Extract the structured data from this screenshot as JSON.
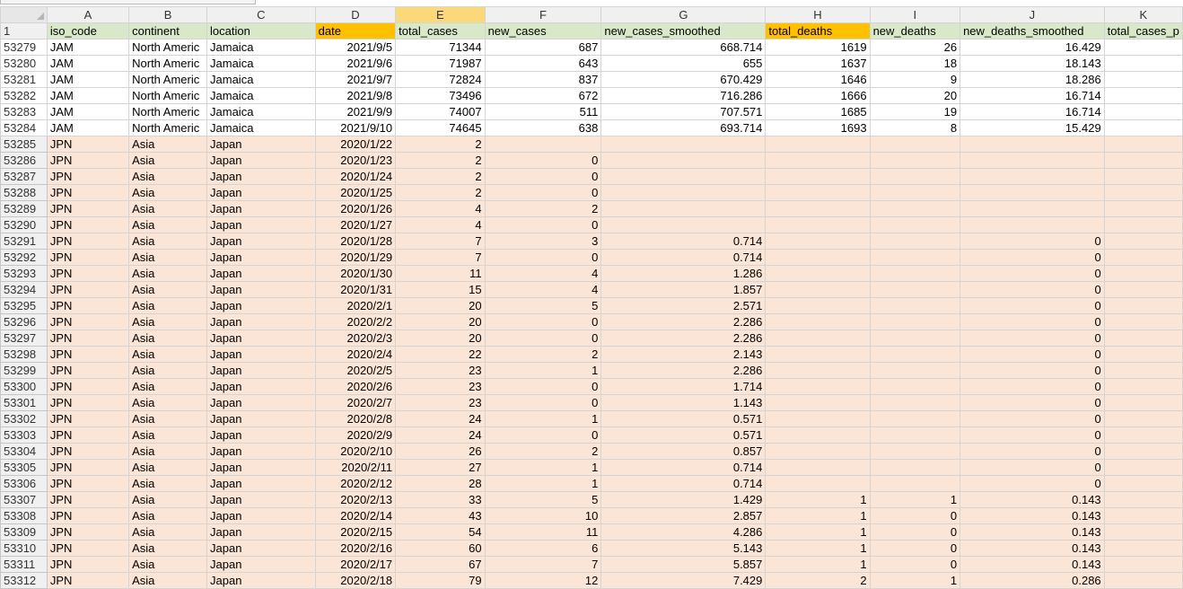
{
  "columns": [
    "A",
    "B",
    "C",
    "D",
    "E",
    "F",
    "G",
    "H",
    "I",
    "J",
    "K"
  ],
  "header_row": {
    "row_number": "1",
    "cells": [
      "iso_code",
      "continent",
      "location",
      "date",
      "total_cases",
      "new_cases",
      "new_cases_smoothed",
      "total_deaths",
      "new_deaths",
      "new_deaths_smoothed",
      "total_cases_p"
    ]
  },
  "rows": [
    {
      "n": "53279",
      "c": [
        "JAM",
        "North Americ",
        "Jamaica",
        "2021/9/5",
        "71344",
        "687",
        "668.714",
        "1619",
        "26",
        "16.429",
        ""
      ]
    },
    {
      "n": "53280",
      "c": [
        "JAM",
        "North Americ",
        "Jamaica",
        "2021/9/6",
        "71987",
        "643",
        "655",
        "1637",
        "18",
        "18.143",
        ""
      ]
    },
    {
      "n": "53281",
      "c": [
        "JAM",
        "North Americ",
        "Jamaica",
        "2021/9/7",
        "72824",
        "837",
        "670.429",
        "1646",
        "9",
        "18.286",
        ""
      ]
    },
    {
      "n": "53282",
      "c": [
        "JAM",
        "North Americ",
        "Jamaica",
        "2021/9/8",
        "73496",
        "672",
        "716.286",
        "1666",
        "20",
        "16.714",
        ""
      ]
    },
    {
      "n": "53283",
      "c": [
        "JAM",
        "North Americ",
        "Jamaica",
        "2021/9/9",
        "74007",
        "511",
        "707.571",
        "1685",
        "19",
        "16.714",
        ""
      ]
    },
    {
      "n": "53284",
      "c": [
        "JAM",
        "North Americ",
        "Jamaica",
        "2021/9/10",
        "74645",
        "638",
        "693.714",
        "1693",
        "8",
        "15.429",
        ""
      ]
    },
    {
      "n": "53285",
      "c": [
        "JPN",
        "Asia",
        "Japan",
        "2020/1/22",
        "2",
        "",
        "",
        "",
        "",
        "",
        ""
      ]
    },
    {
      "n": "53286",
      "c": [
        "JPN",
        "Asia",
        "Japan",
        "2020/1/23",
        "2",
        "0",
        "",
        "",
        "",
        "",
        ""
      ]
    },
    {
      "n": "53287",
      "c": [
        "JPN",
        "Asia",
        "Japan",
        "2020/1/24",
        "2",
        "0",
        "",
        "",
        "",
        "",
        ""
      ]
    },
    {
      "n": "53288",
      "c": [
        "JPN",
        "Asia",
        "Japan",
        "2020/1/25",
        "2",
        "0",
        "",
        "",
        "",
        "",
        ""
      ]
    },
    {
      "n": "53289",
      "c": [
        "JPN",
        "Asia",
        "Japan",
        "2020/1/26",
        "4",
        "2",
        "",
        "",
        "",
        "",
        ""
      ]
    },
    {
      "n": "53290",
      "c": [
        "JPN",
        "Asia",
        "Japan",
        "2020/1/27",
        "4",
        "0",
        "",
        "",
        "",
        "",
        ""
      ]
    },
    {
      "n": "53291",
      "c": [
        "JPN",
        "Asia",
        "Japan",
        "2020/1/28",
        "7",
        "3",
        "0.714",
        "",
        "",
        "0",
        ""
      ]
    },
    {
      "n": "53292",
      "c": [
        "JPN",
        "Asia",
        "Japan",
        "2020/1/29",
        "7",
        "0",
        "0.714",
        "",
        "",
        "0",
        ""
      ]
    },
    {
      "n": "53293",
      "c": [
        "JPN",
        "Asia",
        "Japan",
        "2020/1/30",
        "11",
        "4",
        "1.286",
        "",
        "",
        "0",
        ""
      ]
    },
    {
      "n": "53294",
      "c": [
        "JPN",
        "Asia",
        "Japan",
        "2020/1/31",
        "15",
        "4",
        "1.857",
        "",
        "",
        "0",
        ""
      ]
    },
    {
      "n": "53295",
      "c": [
        "JPN",
        "Asia",
        "Japan",
        "2020/2/1",
        "20",
        "5",
        "2.571",
        "",
        "",
        "0",
        ""
      ]
    },
    {
      "n": "53296",
      "c": [
        "JPN",
        "Asia",
        "Japan",
        "2020/2/2",
        "20",
        "0",
        "2.286",
        "",
        "",
        "0",
        ""
      ]
    },
    {
      "n": "53297",
      "c": [
        "JPN",
        "Asia",
        "Japan",
        "2020/2/3",
        "20",
        "0",
        "2.286",
        "",
        "",
        "0",
        ""
      ]
    },
    {
      "n": "53298",
      "c": [
        "JPN",
        "Asia",
        "Japan",
        "2020/2/4",
        "22",
        "2",
        "2.143",
        "",
        "",
        "0",
        ""
      ]
    },
    {
      "n": "53299",
      "c": [
        "JPN",
        "Asia",
        "Japan",
        "2020/2/5",
        "23",
        "1",
        "2.286",
        "",
        "",
        "0",
        ""
      ]
    },
    {
      "n": "53300",
      "c": [
        "JPN",
        "Asia",
        "Japan",
        "2020/2/6",
        "23",
        "0",
        "1.714",
        "",
        "",
        "0",
        ""
      ]
    },
    {
      "n": "53301",
      "c": [
        "JPN",
        "Asia",
        "Japan",
        "2020/2/7",
        "23",
        "0",
        "1.143",
        "",
        "",
        "0",
        ""
      ]
    },
    {
      "n": "53302",
      "c": [
        "JPN",
        "Asia",
        "Japan",
        "2020/2/8",
        "24",
        "1",
        "0.571",
        "",
        "",
        "0",
        ""
      ]
    },
    {
      "n": "53303",
      "c": [
        "JPN",
        "Asia",
        "Japan",
        "2020/2/9",
        "24",
        "0",
        "0.571",
        "",
        "",
        "0",
        ""
      ]
    },
    {
      "n": "53304",
      "c": [
        "JPN",
        "Asia",
        "Japan",
        "2020/2/10",
        "26",
        "2",
        "0.857",
        "",
        "",
        "0",
        ""
      ]
    },
    {
      "n": "53305",
      "c": [
        "JPN",
        "Asia",
        "Japan",
        "2020/2/11",
        "27",
        "1",
        "0.714",
        "",
        "",
        "0",
        ""
      ]
    },
    {
      "n": "53306",
      "c": [
        "JPN",
        "Asia",
        "Japan",
        "2020/2/12",
        "28",
        "1",
        "0.714",
        "",
        "",
        "0",
        ""
      ]
    },
    {
      "n": "53307",
      "c": [
        "JPN",
        "Asia",
        "Japan",
        "2020/2/13",
        "33",
        "5",
        "1.429",
        "1",
        "1",
        "0.143",
        ""
      ]
    },
    {
      "n": "53308",
      "c": [
        "JPN",
        "Asia",
        "Japan",
        "2020/2/14",
        "43",
        "10",
        "2.857",
        "1",
        "0",
        "0.143",
        ""
      ]
    },
    {
      "n": "53309",
      "c": [
        "JPN",
        "Asia",
        "Japan",
        "2020/2/15",
        "54",
        "11",
        "4.286",
        "1",
        "0",
        "0.143",
        ""
      ]
    },
    {
      "n": "53310",
      "c": [
        "JPN",
        "Asia",
        "Japan",
        "2020/2/16",
        "60",
        "6",
        "5.143",
        "1",
        "0",
        "0.143",
        ""
      ]
    },
    {
      "n": "53311",
      "c": [
        "JPN",
        "Asia",
        "Japan",
        "2020/2/17",
        "67",
        "7",
        "5.857",
        "1",
        "0",
        "0.143",
        ""
      ]
    },
    {
      "n": "53312",
      "c": [
        "JPN",
        "Asia",
        "Japan",
        "2020/2/18",
        "79",
        "12",
        "7.429",
        "2",
        "1",
        "0.286",
        ""
      ]
    }
  ],
  "colors": {
    "header_green": "#d9e8c8",
    "header_orange": "#ffc000",
    "row_peach": "#fbe5d6",
    "selected_col": "#fbd97a"
  }
}
